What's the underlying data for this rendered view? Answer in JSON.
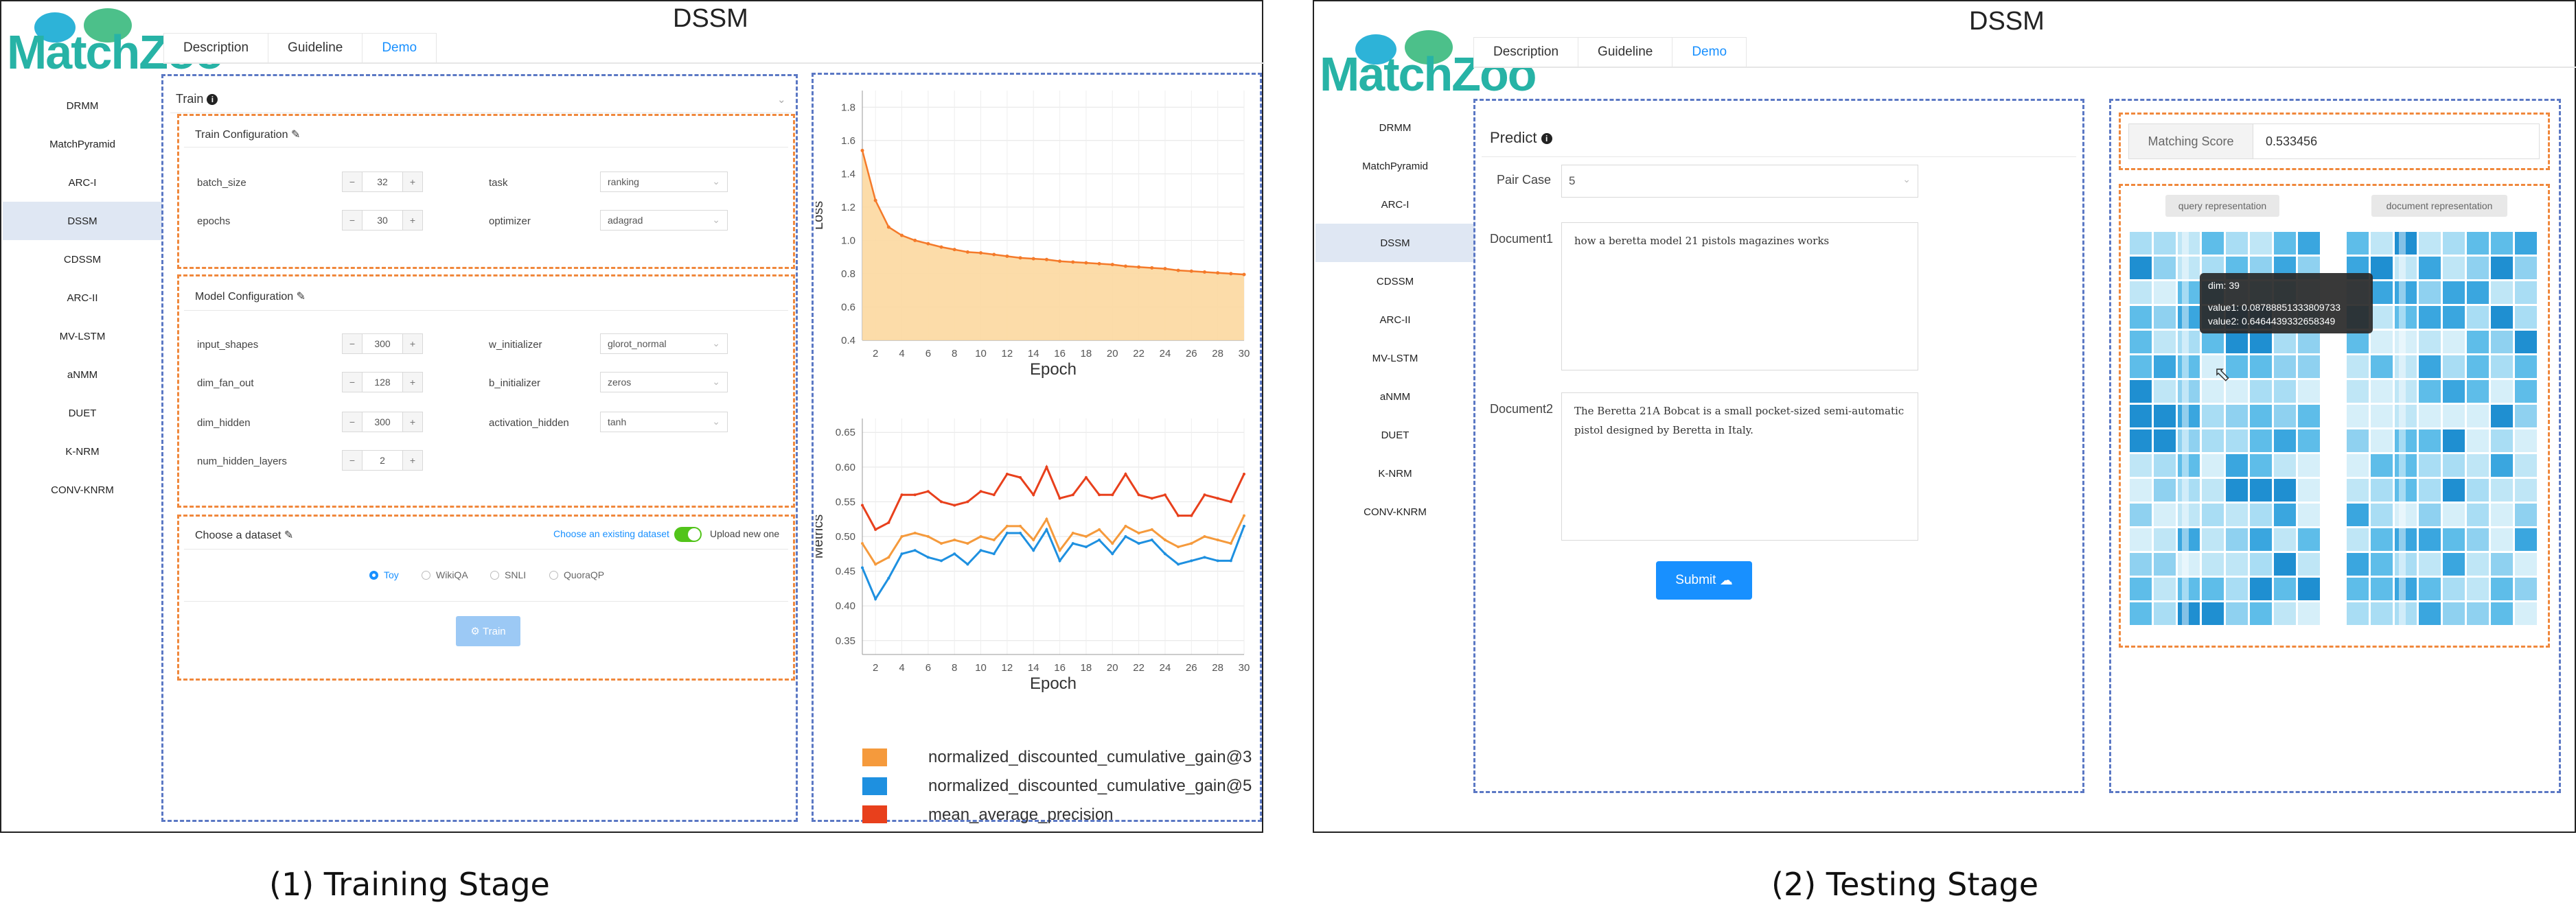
{
  "app_title": "DSSM",
  "logo_text": "MatchZoo",
  "tabs": [
    "Description",
    "Guideline",
    "Demo"
  ],
  "active_tab": "Demo",
  "sidebar": [
    "DRMM",
    "MatchPyramid",
    "ARC-I",
    "DSSM",
    "CDSSM",
    "ARC-II",
    "MV-LSTM",
    "aNMM",
    "DUET",
    "K-NRM",
    "CONV-KNRM"
  ],
  "active_model": "DSSM",
  "captions": {
    "left": "(1)  Training Stage",
    "right": "(2)  Testing Stage"
  },
  "train": {
    "title": "Train",
    "train_config": {
      "title": "Train Configuration",
      "fields": [
        {
          "label": "batch_size",
          "value": "32"
        },
        {
          "label": "epochs",
          "value": "30"
        }
      ],
      "selects": [
        {
          "label": "task",
          "value": "ranking"
        },
        {
          "label": "optimizer",
          "value": "adagrad"
        }
      ]
    },
    "model_config": {
      "title": "Model Configuration",
      "fields": [
        {
          "label": "input_shapes",
          "value": "300"
        },
        {
          "label": "dim_fan_out",
          "value": "128"
        },
        {
          "label": "dim_hidden",
          "value": "300"
        },
        {
          "label": "num_hidden_layers",
          "value": "2"
        }
      ],
      "selects": [
        {
          "label": "w_initializer",
          "value": "glorot_normal"
        },
        {
          "label": "b_initializer",
          "value": "zeros"
        },
        {
          "label": "activation_hidden",
          "value": "tanh"
        }
      ]
    },
    "dataset": {
      "title": "Choose a dataset",
      "existing_link": "Choose an existing dataset",
      "upload_label": "Upload new one",
      "options": [
        "Toy",
        "WikiQA",
        "SNLI",
        "QuoraQP"
      ],
      "selected": "Toy"
    },
    "train_button": "Train"
  },
  "chart_data": [
    {
      "type": "area",
      "ylabel": "Loss",
      "xlabel": "Epoch",
      "x": [
        1,
        2,
        3,
        4,
        5,
        6,
        7,
        8,
        9,
        10,
        11,
        12,
        13,
        14,
        15,
        16,
        17,
        18,
        19,
        20,
        21,
        22,
        23,
        24,
        25,
        26,
        27,
        28,
        29,
        30
      ],
      "xticks": [
        2,
        4,
        6,
        8,
        10,
        12,
        14,
        16,
        18,
        20,
        22,
        24,
        26,
        28,
        30
      ],
      "yticks": [
        "0.4",
        "0.6",
        "0.8",
        "1.0",
        "1.2",
        "1.4",
        "1.6",
        "1.8"
      ],
      "ylim": [
        0.4,
        1.9
      ],
      "values": [
        1.54,
        1.24,
        1.08,
        1.03,
        1.0,
        0.98,
        0.96,
        0.945,
        0.93,
        0.925,
        0.915,
        0.905,
        0.895,
        0.89,
        0.885,
        0.875,
        0.87,
        0.865,
        0.86,
        0.855,
        0.845,
        0.84,
        0.835,
        0.83,
        0.82,
        0.815,
        0.81,
        0.805,
        0.8,
        0.795
      ],
      "color": "#f47a2a",
      "fill": "#fcd8a0"
    },
    {
      "type": "line",
      "ylabel": "Metrics",
      "xlabel": "Epoch",
      "x": [
        1,
        2,
        3,
        4,
        5,
        6,
        7,
        8,
        9,
        10,
        11,
        12,
        13,
        14,
        15,
        16,
        17,
        18,
        19,
        20,
        21,
        22,
        23,
        24,
        25,
        26,
        27,
        28,
        29,
        30
      ],
      "xticks": [
        2,
        4,
        6,
        8,
        10,
        12,
        14,
        16,
        18,
        20,
        22,
        24,
        26,
        28,
        30
      ],
      "yticks": [
        "0.35",
        "0.40",
        "0.45",
        "0.50",
        "0.55",
        "0.60",
        "0.65"
      ],
      "ylim": [
        0.33,
        0.67
      ],
      "series": [
        {
          "name": "mean_average_precision",
          "color": "#e8401c",
          "values": [
            0.545,
            0.51,
            0.52,
            0.56,
            0.56,
            0.565,
            0.55,
            0.545,
            0.55,
            0.565,
            0.56,
            0.59,
            0.585,
            0.56,
            0.6,
            0.555,
            0.56,
            0.585,
            0.56,
            0.56,
            0.59,
            0.56,
            0.555,
            0.56,
            0.53,
            0.53,
            0.56,
            0.555,
            0.55,
            0.59
          ]
        },
        {
          "name": "normalized_discounted_cumulative_gain@3",
          "color": "#f59a3c",
          "values": [
            0.49,
            0.46,
            0.47,
            0.5,
            0.505,
            0.5,
            0.49,
            0.495,
            0.49,
            0.5,
            0.495,
            0.515,
            0.515,
            0.495,
            0.525,
            0.48,
            0.505,
            0.5,
            0.51,
            0.49,
            0.515,
            0.505,
            0.51,
            0.495,
            0.485,
            0.49,
            0.5,
            0.495,
            0.49,
            0.53
          ]
        },
        {
          "name": "normalized_discounted_cumulative_gain@5",
          "color": "#1e90e0",
          "values": [
            0.455,
            0.41,
            0.44,
            0.475,
            0.48,
            0.47,
            0.465,
            0.475,
            0.46,
            0.48,
            0.475,
            0.505,
            0.505,
            0.48,
            0.51,
            0.465,
            0.49,
            0.485,
            0.495,
            0.475,
            0.5,
            0.49,
            0.495,
            0.475,
            0.46,
            0.465,
            0.47,
            0.465,
            0.465,
            0.515
          ]
        }
      ]
    }
  ],
  "predict": {
    "title": "Predict",
    "pair_case_label": "Pair Case",
    "pair_case_value": "5",
    "doc1_label": "Document1",
    "doc1_text": "how a beretta model 21 pistols magazines works",
    "doc2_label": "Document2",
    "doc2_text": "The Beretta 21A Bobcat is a small pocket-sized semi-automatic pistol designed by Beretta in Italy.",
    "submit_label": "Submit"
  },
  "matching": {
    "score_label": "Matching Score",
    "score_value": "0.533456",
    "query_btn": "query representation",
    "doc_btn": "document representation",
    "tooltip": {
      "dim": "dim: 39",
      "value1": "value1: 0.08788851333809733",
      "value2": "value2: 0.6464439332658349"
    }
  },
  "colors": {
    "accent": "#1890ff",
    "orange_dash": "#f0883c",
    "blue_dash": "#5b78c4",
    "teal_logo": "#27b3a6"
  }
}
